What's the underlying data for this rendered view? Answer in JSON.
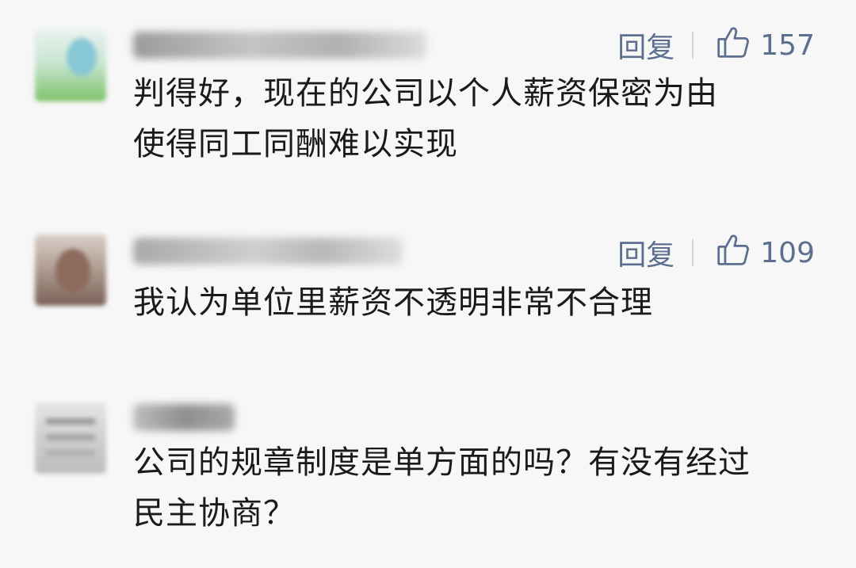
{
  "comments": [
    {
      "text": "判得好，现在的公司以个人薪资保密为由\n使得同工同酬难以实现",
      "reply_label": "回复",
      "likes": "157"
    },
    {
      "text": "我认为单位里薪资不透明非常不合理",
      "reply_label": "回复",
      "likes": "109"
    },
    {
      "text": "公司的规章制度是单方面的吗？有没有经过\n民主协商？"
    }
  ],
  "colors": {
    "action": "#5d6f8f",
    "text": "#1a1a1a",
    "background": "#f7f7f7"
  },
  "icons": {
    "like": "thumbs-up-icon"
  }
}
